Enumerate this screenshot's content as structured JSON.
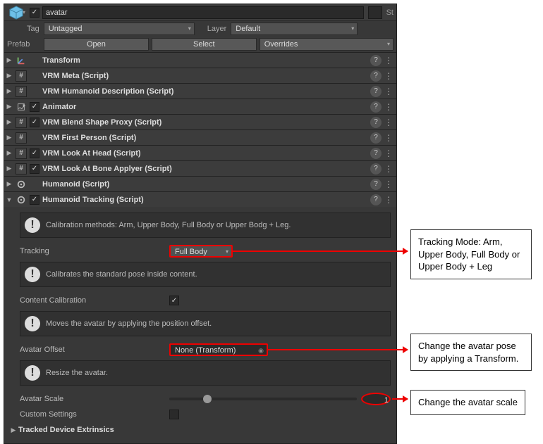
{
  "header": {
    "object_name": "avatar",
    "active": true,
    "static_label": "St",
    "tag_label": "Tag",
    "tag_value": "Untagged",
    "layer_label": "Layer",
    "layer_value": "Default"
  },
  "prefab": {
    "label": "Prefab",
    "open": "Open",
    "select": "Select",
    "overrides": "Overrides"
  },
  "components": [
    {
      "name": "Transform",
      "icon": "transform",
      "enabled_checkbox": false
    },
    {
      "name": "VRM Meta (Script)",
      "icon": "hash",
      "enabled_checkbox": false
    },
    {
      "name": "VRM Humanoid Description (Script)",
      "icon": "hash",
      "enabled_checkbox": false
    },
    {
      "name": "Animator",
      "icon": "anim",
      "enabled_checkbox": true,
      "enabled": true
    },
    {
      "name": "VRM Blend Shape Proxy (Script)",
      "icon": "hash",
      "enabled_checkbox": true,
      "enabled": true
    },
    {
      "name": "VRM First Person (Script)",
      "icon": "hash",
      "enabled_checkbox": false
    },
    {
      "name": "VRM Look At Head (Script)",
      "icon": "hash",
      "enabled_checkbox": true,
      "enabled": true
    },
    {
      "name": "VRM Look At Bone Applyer (Script)",
      "icon": "hash",
      "enabled_checkbox": true,
      "enabled": true
    },
    {
      "name": "Humanoid (Script)",
      "icon": "gear",
      "enabled_checkbox": false
    },
    {
      "name": "Humanoid Tracking (Script)",
      "icon": "gear",
      "enabled_checkbox": true,
      "enabled": true,
      "expanded": true
    }
  ],
  "humanoid_tracking": {
    "info1": "Calibration methods: Arm, Upper Body, Full Body or Upper Bodg + Leg.",
    "tracking_label": "Tracking",
    "tracking_value": "Full Body",
    "info2": "Calibrates the standard pose inside content.",
    "content_calibration_label": "Content Calibration",
    "content_calibration_value": true,
    "info3": "Moves the avatar by applying the position offset.",
    "avatar_offset_label": "Avatar Offset",
    "avatar_offset_value": "None (Transform)",
    "info4": "Resize the avatar.",
    "avatar_scale_label": "Avatar Scale",
    "avatar_scale_value": "1",
    "custom_settings_label": "Custom Settings",
    "custom_settings_value": false,
    "tracked_device_label": "Tracked Device Extrinsics"
  },
  "annotations": {
    "a1": "Tracking Mode: Arm, Upper Body, Full Body or Upper Body + Leg",
    "a2": "Change the avatar pose by applying a Transform.",
    "a3": "Change the avatar scale"
  }
}
